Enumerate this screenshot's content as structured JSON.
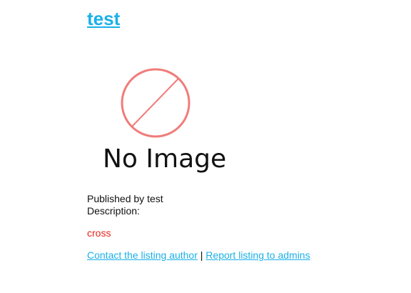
{
  "listing": {
    "title": "test",
    "image_placeholder_text": "No Image",
    "published_by_label": "Published by",
    "published_by_user": "test",
    "description_label": "Description:",
    "description_text": "cross"
  },
  "actions": {
    "contact_author": "Contact the listing author",
    "separator": "|",
    "report_listing": "Report listing to admins"
  },
  "colors": {
    "link": "#1ab0e8",
    "description": "#e8231c",
    "placeholder_icon": "#f07c7a",
    "text": "#111111"
  },
  "icons": {
    "placeholder": "no-image-icon"
  }
}
